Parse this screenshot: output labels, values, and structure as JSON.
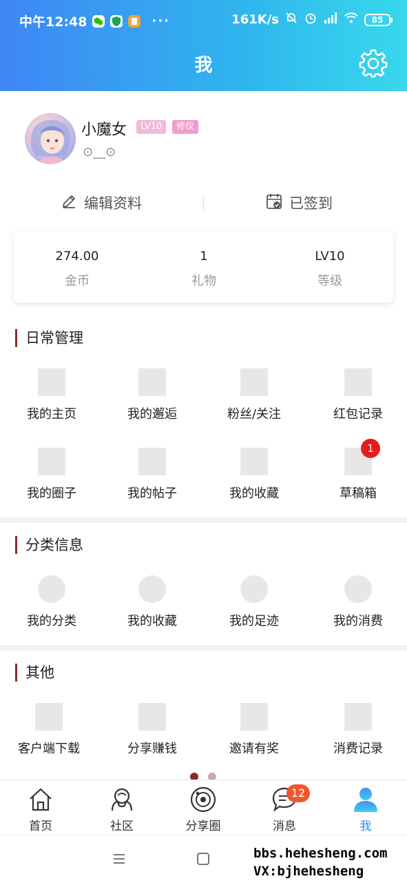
{
  "status_bar": {
    "time": "中午12:48",
    "more": "···",
    "net_speed": "161K/s",
    "battery": "85"
  },
  "header": {
    "title": "我"
  },
  "profile": {
    "username": "小魔女",
    "level_badge": "LV10",
    "title_badge": "修仪",
    "signature": "⊙__⊙"
  },
  "actions": {
    "edit": "编辑资料",
    "signin": "已签到"
  },
  "stats": [
    {
      "value": "274.00",
      "label": "金币"
    },
    {
      "value": "1",
      "label": "礼物"
    },
    {
      "value": "LV10",
      "label": "等级"
    }
  ],
  "sections": {
    "daily": {
      "title": "日常管理",
      "items": [
        "我的主页",
        "我的邂逅",
        "粉丝/关注",
        "红包记录",
        "我的圈子",
        "我的帖子",
        "我的收藏",
        "草稿箱"
      ],
      "drafts_badge": "1"
    },
    "classified": {
      "title": "分类信息",
      "items": [
        "我的分类",
        "我的收藏",
        "我的足迹",
        "我的消费"
      ]
    },
    "other": {
      "title": "其他",
      "items": [
        "客户端下载",
        "分享赚钱",
        "邀请有奖",
        "消费记录"
      ]
    }
  },
  "tabs": [
    {
      "label": "首页",
      "icon": "home-icon"
    },
    {
      "label": "社区",
      "icon": "community-icon"
    },
    {
      "label": "分享圈",
      "icon": "share-circle-icon"
    },
    {
      "label": "消息",
      "icon": "message-icon",
      "badge": "12"
    },
    {
      "label": "我",
      "icon": "profile-icon",
      "active": true
    }
  ],
  "watermark": {
    "line1": "bbs.hehesheng.com",
    "line2": "VX:bjhehesheng"
  },
  "colors": {
    "header_start": "#3f86f5",
    "header_end": "#38d8ec",
    "accent": "#2f8ff0",
    "section_bar": "#8b2a2a",
    "notification": "#e81b1b"
  }
}
